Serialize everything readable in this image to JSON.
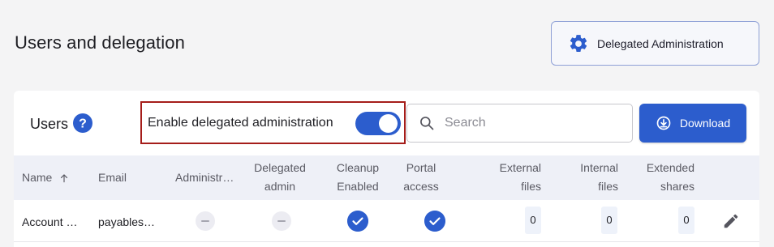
{
  "page": {
    "title": "Users and delegation"
  },
  "header": {
    "delegated_admin_label": "Delegated Administration",
    "icon": "gear-icon"
  },
  "users_panel": {
    "title": "Users",
    "help_icon": "help-icon",
    "toggle": {
      "label": "Enable delegated administration",
      "on": true
    },
    "search": {
      "placeholder": "Search",
      "value": ""
    },
    "download_label": "Download"
  },
  "table": {
    "columns": [
      {
        "line1": "Name",
        "line2": "",
        "sort": "ascending"
      },
      {
        "line1": "Email",
        "line2": ""
      },
      {
        "line1": "Administr…",
        "line2": ""
      },
      {
        "line1": "Delegated",
        "line2": "admin"
      },
      {
        "line1": "Cleanup",
        "line2": "Enabled"
      },
      {
        "line1": "Portal",
        "line2": "access"
      },
      {
        "line1": "External",
        "line2": "files"
      },
      {
        "line1": "Internal",
        "line2": "files"
      },
      {
        "line1": "Extended",
        "line2": "shares"
      }
    ],
    "rows": [
      {
        "name": "Account …",
        "email": "payables…",
        "administrator": false,
        "delegated_admin": false,
        "cleanup_enabled": true,
        "portal_access": true,
        "external_files": "0",
        "internal_files": "0",
        "extended_shares": "0"
      }
    ]
  },
  "colors": {
    "accent": "#2c5dcd",
    "highlight_border": "#a51d1a",
    "background": "#f4f4f5"
  }
}
